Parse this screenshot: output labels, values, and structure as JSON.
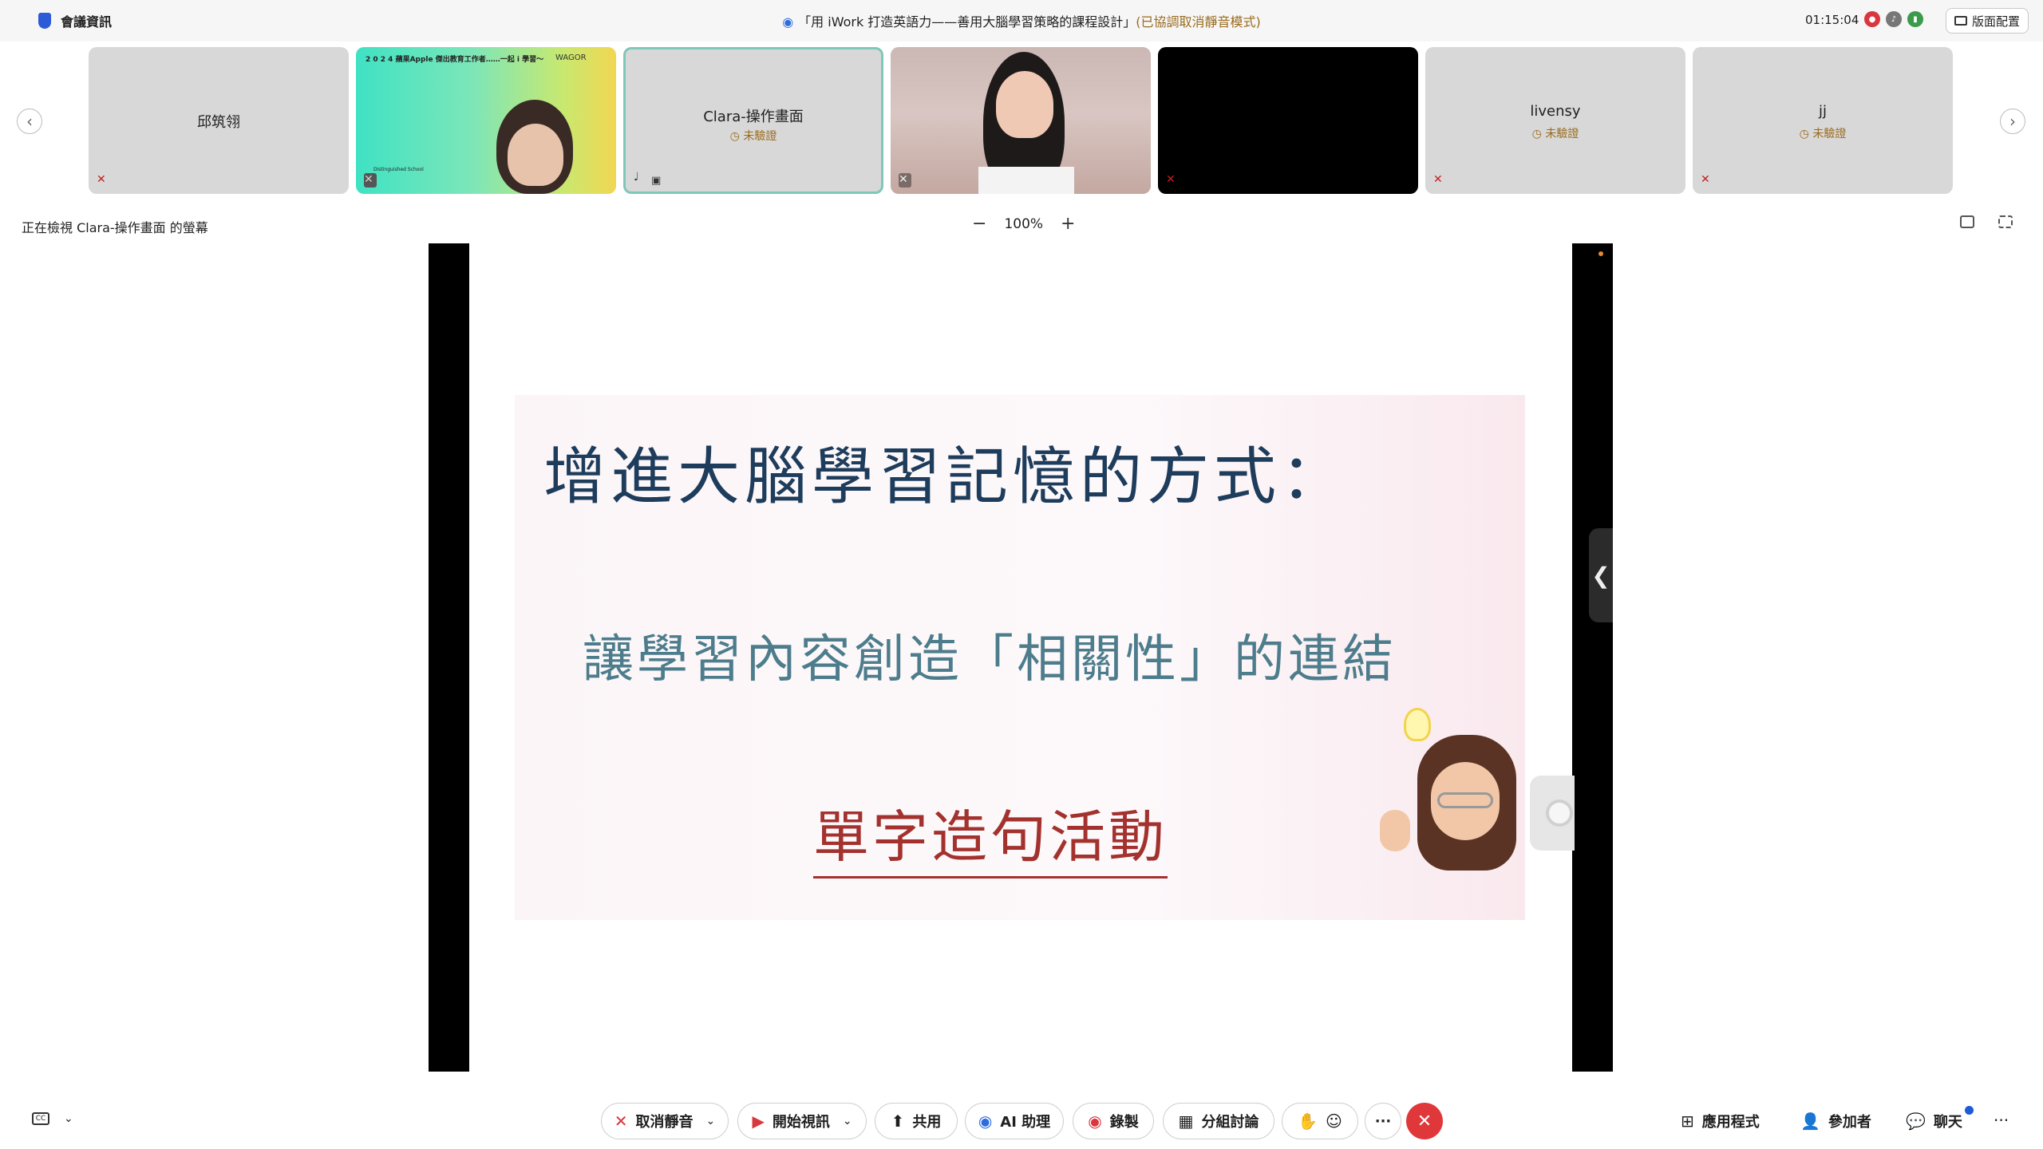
{
  "titlebar": {
    "meeting_info_label": "會議資訊",
    "window_title": "「用 iWork 打造英語力——善用大腦學習策略的課程設計」",
    "mute_mode_note": "(已協調取消靜音模式)",
    "clock": "01:15:04",
    "layout_button_label": "版面配置"
  },
  "participants": [
    {
      "name": "邱筑翎",
      "verified_label": "",
      "mic": "muted"
    },
    {
      "name": "",
      "verified_label": "",
      "mic": "muted",
      "banner_text": "2 0 2 4 蘋果Apple 傑出教育工作者……一起 i 學習～",
      "badge": "WAGOR",
      "school": "Distinguished School"
    },
    {
      "name": "Clara-操作畫面",
      "verified_label": "未驗證",
      "mic": "on",
      "active": true
    },
    {
      "name": "",
      "verified_label": "",
      "mic": "muted"
    },
    {
      "name": "",
      "verified_label": "",
      "mic": "muted"
    },
    {
      "name": "livensy",
      "verified_label": "未驗證",
      "mic": "muted"
    },
    {
      "name": "jj",
      "verified_label": "未驗證",
      "mic": "muted"
    }
  ],
  "share_bar": {
    "viewing_label": "正在檢視 Clara-操作畫面 的螢幕",
    "zoom_value": "100%",
    "zoom_out": "−",
    "zoom_in": "+"
  },
  "slide": {
    "heading": "增進大腦學習記憶的方式：",
    "subheading": "讓學習內容創造「相關性」的連結",
    "activity": "單字造句活動"
  },
  "toolbar": {
    "unmute_label": "取消靜音",
    "start_video_label": "開始視訊",
    "share_label": "共用",
    "ai_label": "AI 助理",
    "record_label": "錄製",
    "breakout_label": "分組討論",
    "more_label": "···",
    "apps_label": "應用程式",
    "participants_label": "參加者",
    "chat_label": "聊天",
    "right_more_label": "···"
  },
  "colors": {
    "accent_blue": "#2d6cdf",
    "end_red": "#e0373a",
    "verify_gold": "#9a6b1e",
    "heading_navy": "#1e3c5c",
    "sub_teal": "#4d7d8c",
    "activity_red": "#a3322e"
  }
}
